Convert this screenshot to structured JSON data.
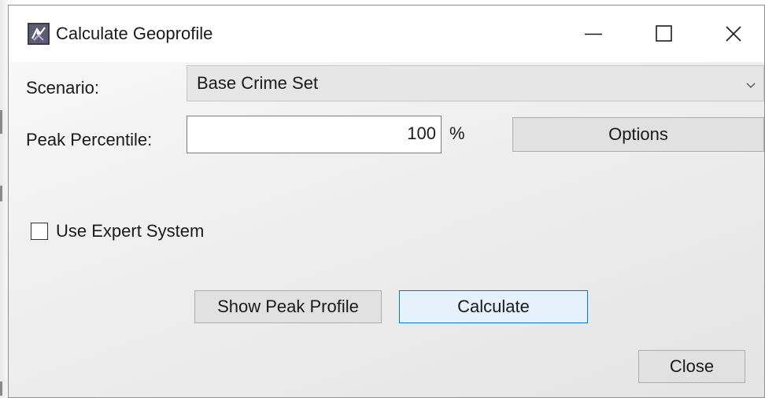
{
  "window": {
    "title": "Calculate Geoprofile",
    "icon": "geoprofile-app-icon",
    "controls": {
      "minimize_icon": "minimize-icon",
      "maximize_icon": "maximize-icon",
      "close_icon": "close-icon"
    }
  },
  "scenario": {
    "label": "Scenario:",
    "value": "Base Crime Set",
    "dropdown_icon": "chevron-down-icon"
  },
  "peak": {
    "label": "Peak Percentile:",
    "value": "100",
    "unit": "%",
    "options_label": "Options"
  },
  "expert": {
    "label": "Use Expert System",
    "checked": false
  },
  "actions": {
    "show_peak_label": "Show Peak Profile",
    "calculate_label": "Calculate",
    "close_label": "Close"
  },
  "colors": {
    "accent": "#0078d7",
    "button_face": "#e1e1e1",
    "combo_face": "#e6e6e6"
  }
}
